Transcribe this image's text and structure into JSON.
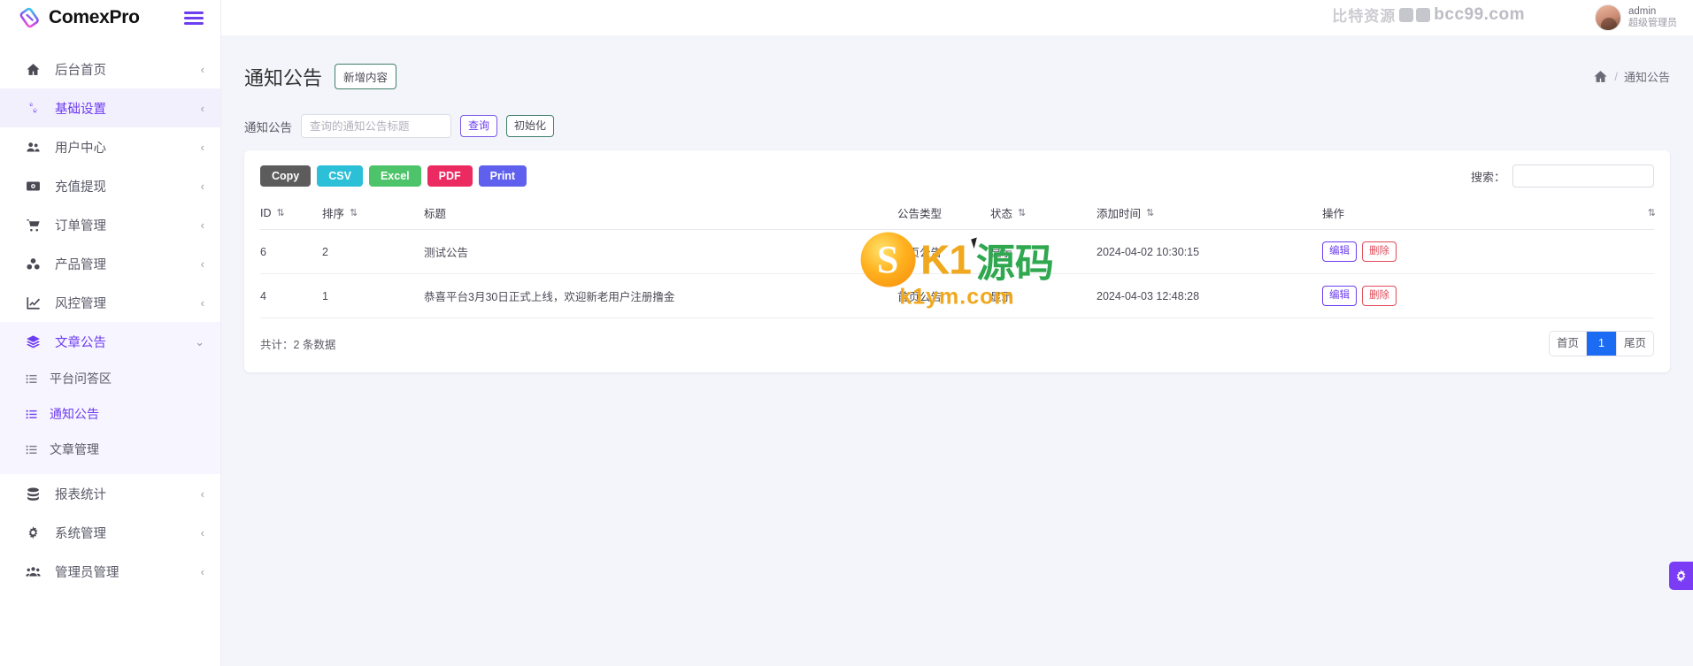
{
  "brand": {
    "name": "ComexPro",
    "menu_toggle": "hamburger-menu"
  },
  "topbar": {
    "watermark_cn": "比特资源",
    "watermark_en": "bcc99.com",
    "user_name": "admin",
    "user_role": "超级管理员"
  },
  "sidebar": {
    "items": [
      {
        "label": "后台首页",
        "icon": "home-icon",
        "arrow": "‹",
        "state": "normal"
      },
      {
        "label": "基础设置",
        "icon": "gears-icon",
        "arrow": "‹",
        "state": "active"
      },
      {
        "label": "用户中心",
        "icon": "users-icon",
        "arrow": "‹",
        "state": "normal"
      },
      {
        "label": "充值提现",
        "icon": "money-icon",
        "arrow": "‹",
        "state": "normal"
      },
      {
        "label": "订单管理",
        "icon": "cart-icon",
        "arrow": "‹",
        "state": "normal"
      },
      {
        "label": "产品管理",
        "icon": "cubes-icon",
        "arrow": "‹",
        "state": "normal"
      },
      {
        "label": "风控管理",
        "icon": "chart-line-icon",
        "arrow": "‹",
        "state": "normal"
      },
      {
        "label": "文章公告",
        "icon": "layers-icon",
        "arrow": "⌄",
        "state": "open"
      },
      {
        "label": "报表统计",
        "icon": "database-icon",
        "arrow": "‹",
        "state": "normal"
      },
      {
        "label": "系统管理",
        "icon": "cog-icon",
        "arrow": "‹",
        "state": "normal"
      },
      {
        "label": "管理员管理",
        "icon": "user-group-icon",
        "arrow": "‹",
        "state": "normal"
      }
    ],
    "submenu": [
      {
        "label": "平台问答区",
        "icon": "list-icon",
        "state": "normal"
      },
      {
        "label": "通知公告",
        "icon": "list-icon",
        "state": "active"
      },
      {
        "label": "文章管理",
        "icon": "list-icon",
        "state": "normal"
      }
    ]
  },
  "page": {
    "title": "通知公告",
    "add_button": "新增内容",
    "breadcrumb_home_icon": "home-icon",
    "breadcrumb_sep": "/",
    "breadcrumb_current": "通知公告"
  },
  "filter": {
    "label": "通知公告",
    "placeholder": "查询的通知公告标题",
    "value": "",
    "query_button": "查询",
    "reset_button": "初始化"
  },
  "table_tools": {
    "export_buttons": [
      {
        "label": "Copy",
        "color": "#5c5c5c"
      },
      {
        "label": "CSV",
        "color": "#2bc0d8"
      },
      {
        "label": "Excel",
        "color": "#4ec46a"
      },
      {
        "label": "PDF",
        "color": "#ec2a62"
      },
      {
        "label": "Print",
        "color": "#5f61ee"
      }
    ],
    "search_label": "搜索：",
    "search_value": "",
    "search_placeholder": ""
  },
  "table": {
    "columns": [
      {
        "label": "ID",
        "sortable": true
      },
      {
        "label": "排序",
        "sortable": true
      },
      {
        "label": "标题",
        "sortable": false
      },
      {
        "label": "公告类型",
        "sortable": false
      },
      {
        "label": "状态",
        "sortable": true
      },
      {
        "label": "添加时间",
        "sortable": true
      },
      {
        "label": "操作",
        "sortable": true
      }
    ],
    "sort_icon": "⇅",
    "rows": [
      {
        "id": "6",
        "order": "2",
        "title": "测试公告",
        "type": "首页公告",
        "status": "显示",
        "created_at": "2024-04-02 10:30:15",
        "edit": "编辑",
        "delete": "删除"
      },
      {
        "id": "4",
        "order": "1",
        "title": "恭喜平台3月30日正式上线，欢迎新老用户注册撸金",
        "type": "首页公告",
        "status": "显示",
        "created_at": "2024-04-03 12:48:28",
        "edit": "编辑",
        "delete": "删除"
      }
    ],
    "total_text": "共计：2 条数据",
    "pager": [
      {
        "label": "首页",
        "active": false
      },
      {
        "label": "1",
        "active": true
      },
      {
        "label": "尾页",
        "active": false
      }
    ]
  },
  "watermark_center": {
    "k1": "K1",
    "cn": "源码",
    "url": "k1ym.com"
  },
  "colors": {
    "accent": "#6d3df0",
    "pager_active": "#1b6cf2",
    "fab": "#7a3df5"
  }
}
